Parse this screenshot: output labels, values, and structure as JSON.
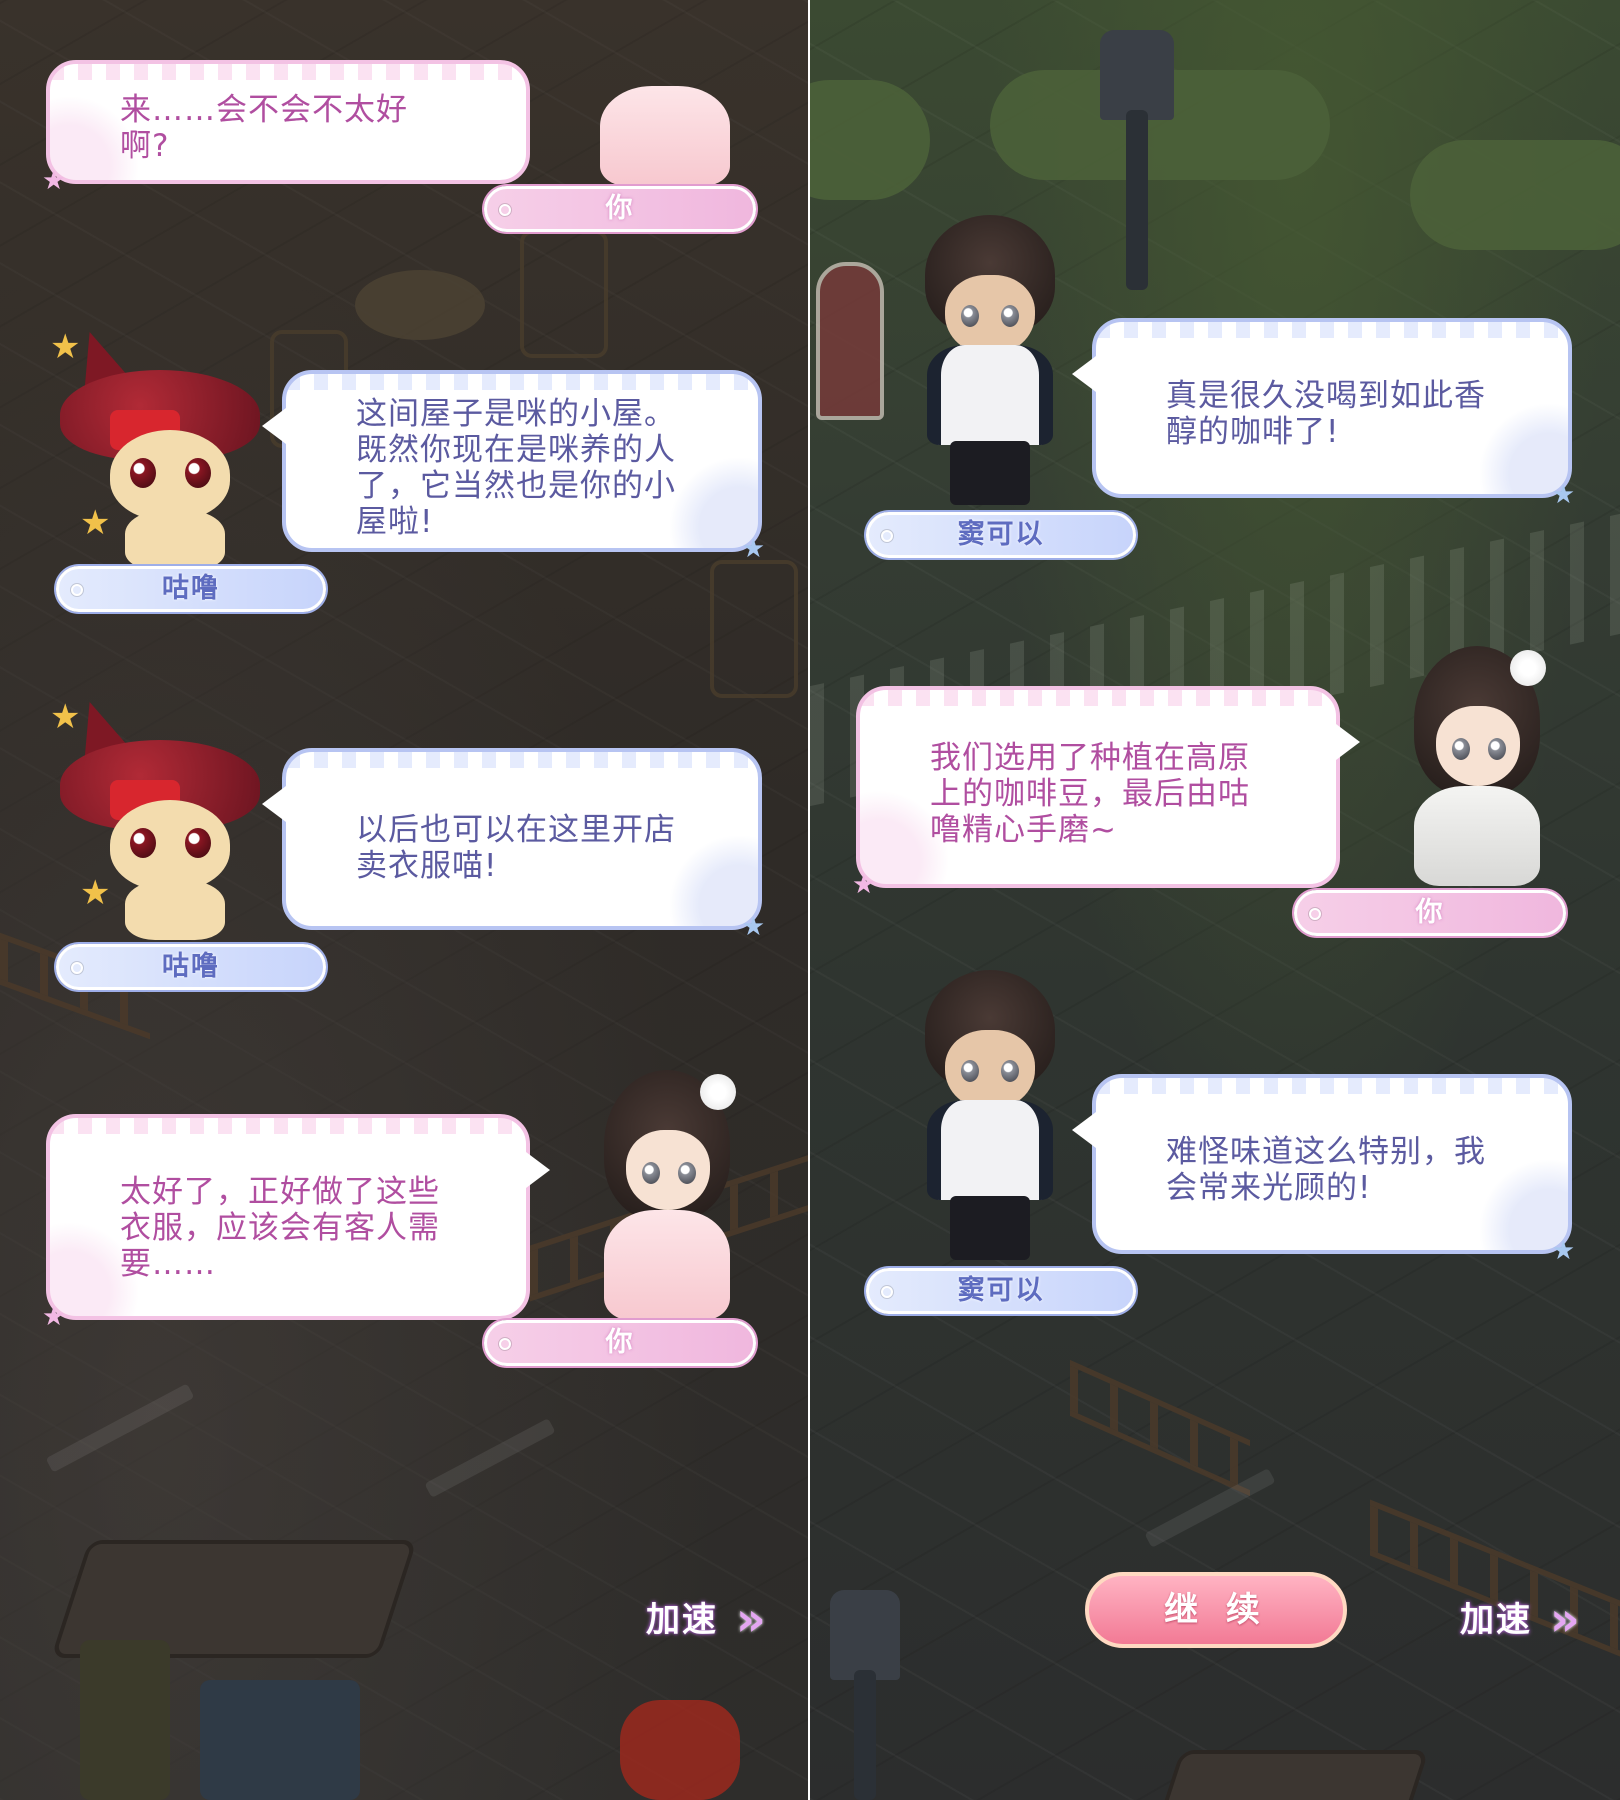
{
  "left_panel": {
    "dialogues": [
      {
        "speaker": "你",
        "text": "来……会不会不太好\n啊?"
      },
      {
        "speaker": "咕噜",
        "text": "这间屋子是咪的小屋。\n既然你现在是咪养的人\n了，它当然也是你的小\n屋啦!"
      },
      {
        "speaker": "咕噜",
        "text": "以后也可以在这里开店\n卖衣服喵!"
      },
      {
        "speaker": "你",
        "text": "太好了，正好做了这些\n衣服，应该会有客人需\n要……"
      }
    ],
    "speed_label": "加速"
  },
  "right_panel": {
    "dialogues": [
      {
        "speaker": "窦可以",
        "text": "真是很久没喝到如此香\n醇的咖啡了!"
      },
      {
        "speaker": "你",
        "text": "我们选用了种植在高原\n上的咖啡豆，最后由咕\n噜精心手磨~"
      },
      {
        "speaker": "窦可以",
        "text": "难怪味道这么特别，我\n会常来光顾的!"
      }
    ],
    "continue_label": "继 续",
    "speed_label": "加速"
  },
  "icons": {
    "star": "★",
    "double_chevron": "»"
  },
  "colors": {
    "blue_text": "#5b5aa0",
    "pink_text": "#b04ea0",
    "blue_border": "#b7c4f2",
    "pink_border": "#f3c2e4",
    "continue_button": "#f27a95"
  }
}
